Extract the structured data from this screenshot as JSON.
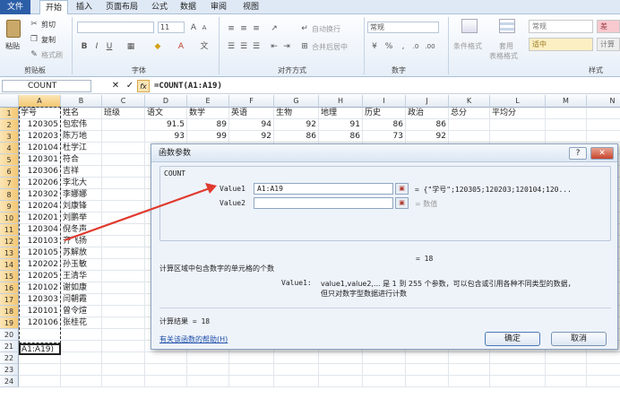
{
  "tabs": [
    "文件",
    "开始",
    "插入",
    "页面布局",
    "公式",
    "数据",
    "审阅",
    "视图"
  ],
  "ribbon": {
    "clipboard": {
      "paste": "粘贴",
      "cut": "剪切",
      "copy": "复制",
      "format_painter": "格式刷",
      "label": "剪贴板"
    },
    "font": {
      "size": "11",
      "label": "字体"
    },
    "align": {
      "wrap": "自动换行",
      "merge": "合并后居中",
      "label": "对齐方式"
    },
    "number": {
      "format": "常规",
      "label": "数字"
    },
    "styles": {
      "conditional": "条件格式",
      "table_format_1": "套用",
      "table_format_2": "表格格式",
      "normal": "常规",
      "medium": "适中",
      "bad": "差",
      "calc": "计算",
      "label": "样式"
    }
  },
  "formula_bar": {
    "name_box": "COUNT",
    "cancel": "✕",
    "enter": "✓",
    "fx": "fx",
    "formula": "=COUNT(A1:A19)"
  },
  "columns": [
    "A",
    "B",
    "C",
    "D",
    "E",
    "F",
    "G",
    "H",
    "I",
    "J",
    "K",
    "L",
    "M",
    "N"
  ],
  "headers": [
    "学号",
    "姓名",
    "班级",
    "语文",
    "数学",
    "英语",
    "生物",
    "地理",
    "历史",
    "政治",
    "总分",
    "平均分"
  ],
  "rows": [
    {
      "id": "120305",
      "name": "包宏伟",
      "scores": [
        "91.5",
        "89",
        "94",
        "92",
        "91",
        "86",
        "86"
      ]
    },
    {
      "id": "120203",
      "name": "陈万地",
      "scores": [
        "93",
        "99",
        "92",
        "86",
        "86",
        "73",
        "92"
      ]
    },
    {
      "id": "120104",
      "name": "杜学江"
    },
    {
      "id": "120301",
      "name": "符合"
    },
    {
      "id": "120306",
      "name": "吉祥"
    },
    {
      "id": "120206",
      "name": "李北大"
    },
    {
      "id": "120302",
      "name": "李娜娜"
    },
    {
      "id": "120204",
      "name": "刘康锋"
    },
    {
      "id": "120201",
      "name": "刘鹏举"
    },
    {
      "id": "120304",
      "name": "倪冬声"
    },
    {
      "id": "120103",
      "name": "齐飞扬"
    },
    {
      "id": "120105",
      "name": "苏解放"
    },
    {
      "id": "120202",
      "name": "孙玉敏"
    },
    {
      "id": "120205",
      "name": "王清华"
    },
    {
      "id": "120102",
      "name": "谢如康"
    },
    {
      "id": "120303",
      "name": "闫朝霞"
    },
    {
      "id": "120101",
      "name": "曾令煊"
    },
    {
      "id": "120106",
      "name": "张桂花"
    }
  ],
  "active_cell_text": "A1:A19)",
  "dialog": {
    "title": "函数参数",
    "help_btn": "?",
    "close_btn": "✕",
    "function_name": "COUNT",
    "value1_label": "Value1",
    "value1": "A1:A19",
    "value1_result": "= {\"学号\";120305;120203;120104;120...",
    "value2_label": "Value2",
    "value2_result": "= 数值",
    "total": "= 18",
    "description": "计算区域中包含数字的单元格的个数",
    "arg_help_label": "Value1:",
    "arg_help_1": "value1,value2,... 是 1 到 255 个参数，可以包含或引用各种不同类型的数据，",
    "arg_help_2": "但只对数字型数据进行计数",
    "calc_result": "计算结果 = 18",
    "help_link": "有关该函数的帮助(H)",
    "ok": "确定",
    "cancel": "取消"
  },
  "colors": {
    "accent": "#2c5ea8",
    "arrow": "#e03a2f",
    "selection": "#f4c772"
  }
}
